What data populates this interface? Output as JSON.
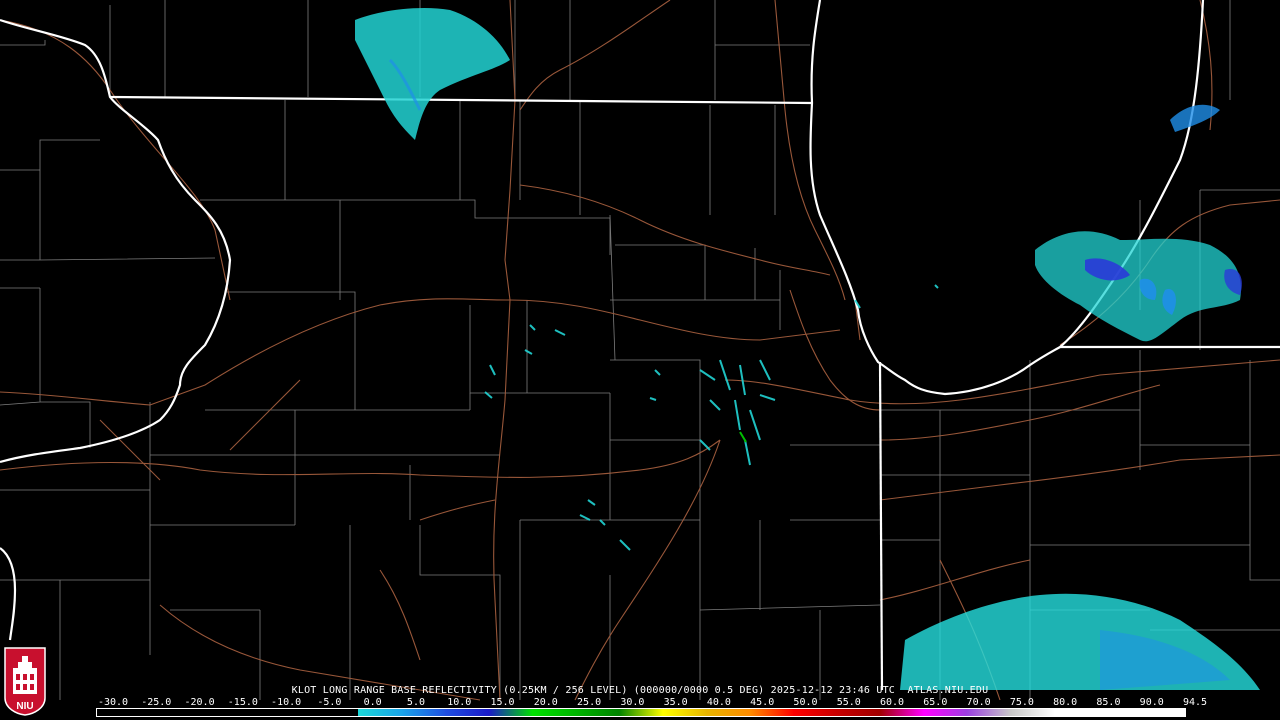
{
  "title": "KLOT LONG RANGE BASE REFLECTIVITY (0.25KM / 256 LEVEL) (000000/0000 0.5 DEG) 2025-12-12 23:46 UTC  ATLAS.NIU.EDU",
  "logo_text": "NIU",
  "scale": {
    "labels": [
      "-30.0",
      "-25.0",
      "-20.0",
      "-15.0",
      "-10.0",
      "-5.0",
      "0.0",
      "5.0",
      "10.0",
      "15.0",
      "20.0",
      "25.0",
      "30.0",
      "35.0",
      "40.0",
      "45.0",
      "50.0",
      "55.0",
      "60.0",
      "65.0",
      "70.0",
      "75.0",
      "80.0",
      "85.0",
      "90.0",
      "94.5"
    ],
    "colors": [
      "#000000",
      "#000000",
      "#000000",
      "#000000",
      "#000000",
      "#000000",
      "#1bd8d8",
      "#1aa3e8",
      "#1f4fe0",
      "#1a1ac8",
      "#00e000",
      "#00b400",
      "#008200",
      "#ffff00",
      "#e6b400",
      "#ff8c00",
      "#ff0000",
      "#c80000",
      "#a00000",
      "#ff00ff",
      "#9b40e0",
      "#c8c8c8",
      "#ffffff",
      "#ffffff",
      "#ffffff"
    ]
  },
  "colors": {
    "state_border": "#ffffff",
    "county_line": "#8a8a8a",
    "highway": "#a05a3a",
    "echo_cyan": "#2ee6e6",
    "echo_blue": "#1f8fe8",
    "echo_deep": "#2a3ad8",
    "logo_red": "#c8102e"
  }
}
